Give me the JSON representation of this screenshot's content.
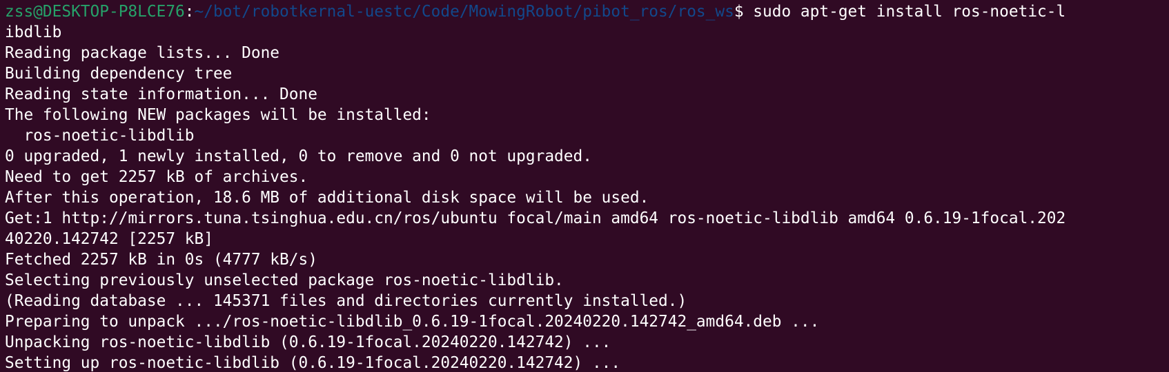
{
  "terminal": {
    "prompt": {
      "user_host": "zss@DESKTOP-P8LCE76",
      "colon": ":",
      "path": "~/bot/robotkernal-uestc/Code/MowingRobot/pibot_ros/ros_ws",
      "dollar": "$ "
    },
    "command": "sudo apt-get install ros-noetic-l",
    "command_wrap": "ibdlib",
    "output": [
      "Reading package lists... Done",
      "Building dependency tree",
      "Reading state information... Done",
      "The following NEW packages will be installed:",
      "  ros-noetic-libdlib",
      "0 upgraded, 1 newly installed, 0 to remove and 0 not upgraded.",
      "Need to get 2257 kB of archives.",
      "After this operation, 18.6 MB of additional disk space will be used.",
      "Get:1 http://mirrors.tuna.tsinghua.edu.cn/ros/ubuntu focal/main amd64 ros-noetic-libdlib amd64 0.6.19-1focal.202",
      "40220.142742 [2257 kB]",
      "Fetched 2257 kB in 0s (4777 kB/s)",
      "Selecting previously unselected package ros-noetic-libdlib.",
      "(Reading database ... 145371 files and directories currently installed.)",
      "Preparing to unpack .../ros-noetic-libdlib_0.6.19-1focal.20240220.142742_amd64.deb ...",
      "Unpacking ros-noetic-libdlib (0.6.19-1focal.20240220.142742) ...",
      "Setting up ros-noetic-libdlib (0.6.19-1focal.20240220.142742) ..."
    ]
  }
}
